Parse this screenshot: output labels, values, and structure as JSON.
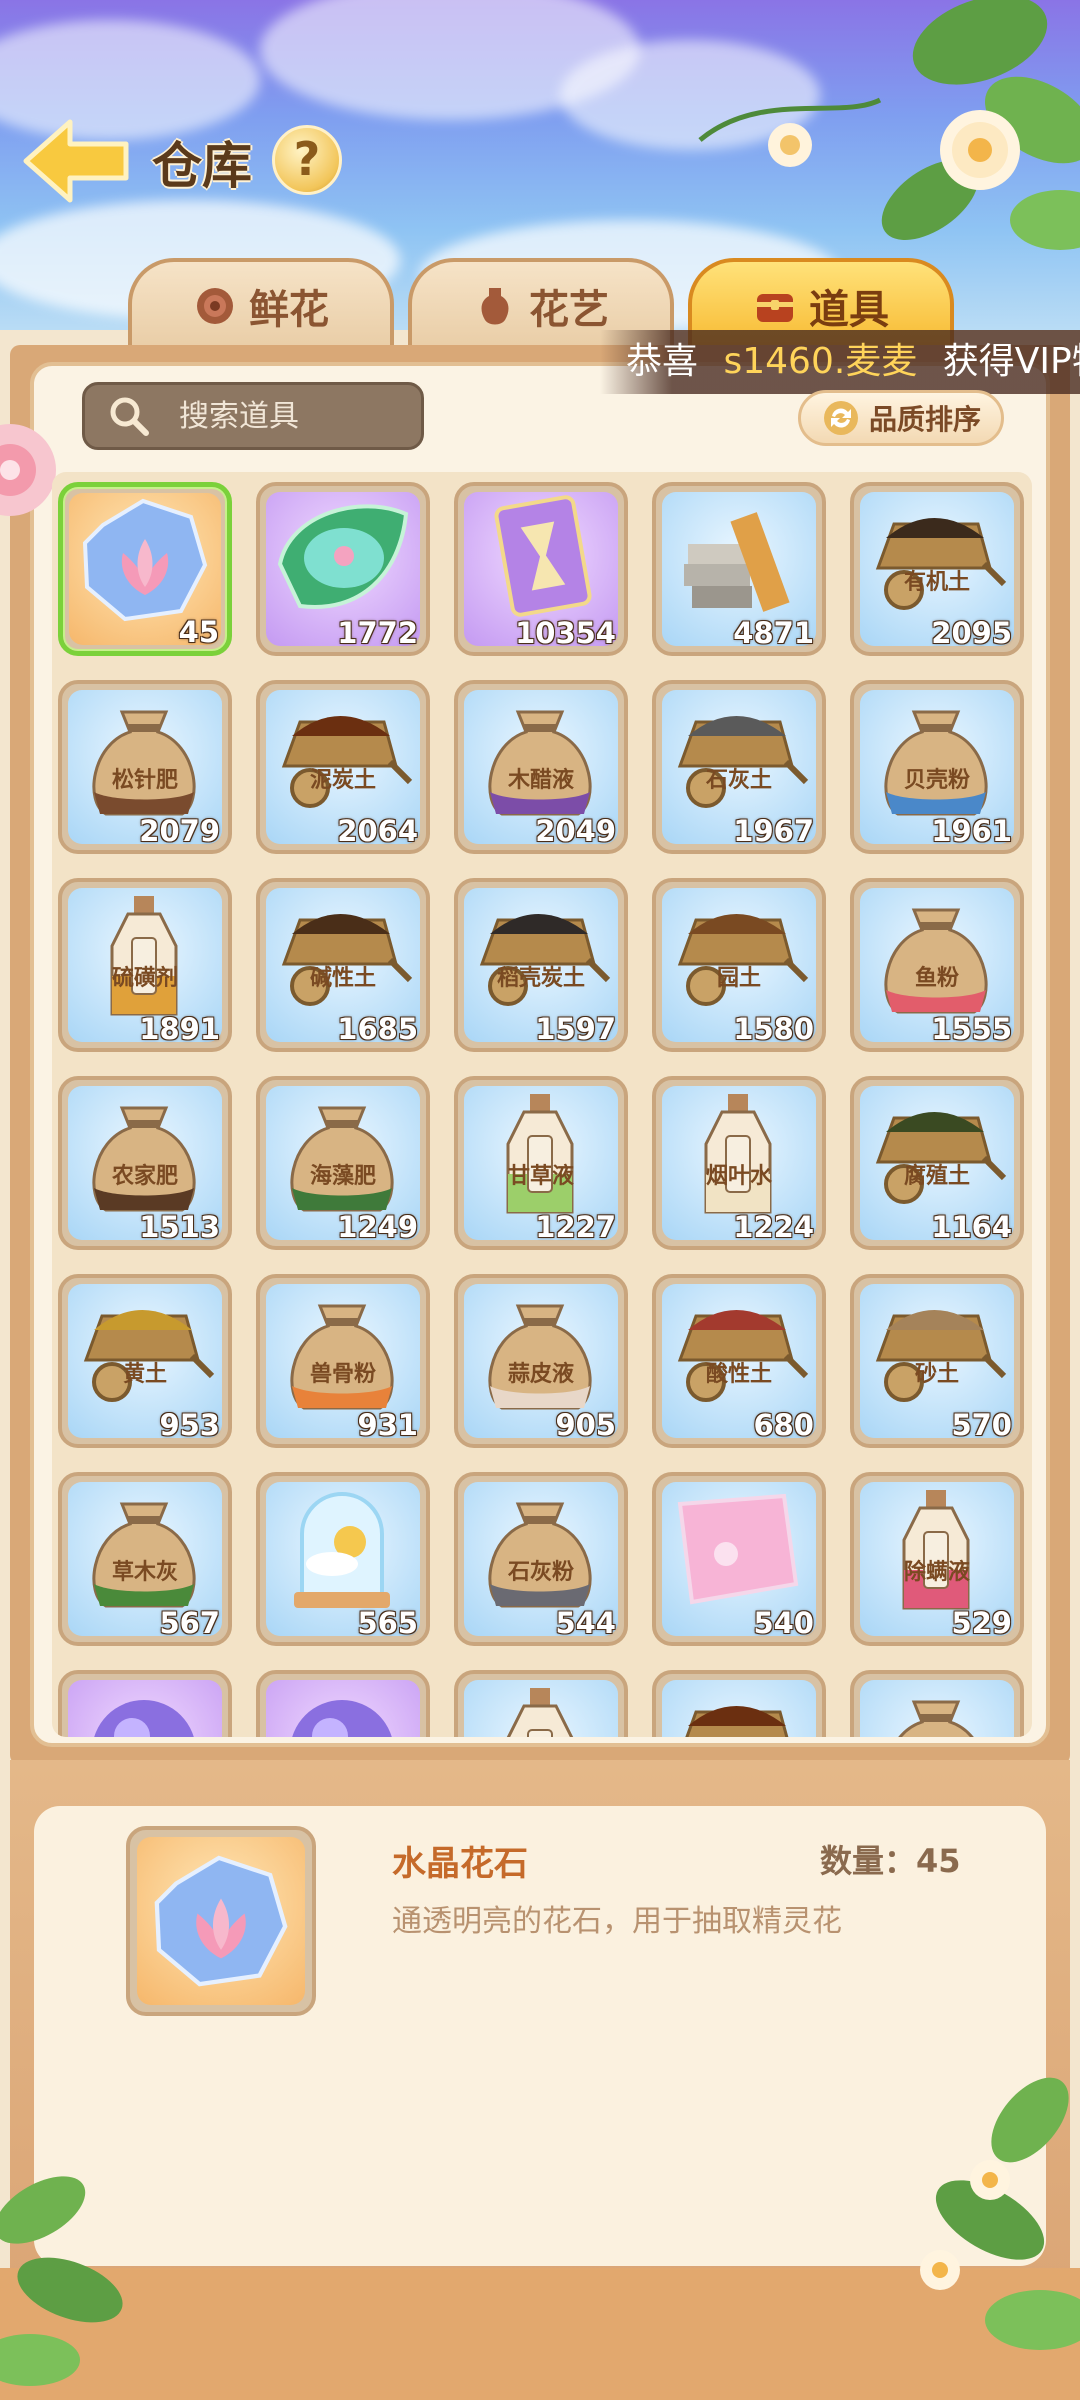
{
  "header": {
    "title": "仓库",
    "help_label": "?"
  },
  "tabs": [
    {
      "label": "鲜花",
      "active": false
    },
    {
      "label": "花艺",
      "active": false
    },
    {
      "label": "道具",
      "active": true
    }
  ],
  "ticker": {
    "prefix": "恭喜",
    "user": "s1460.麦麦",
    "suffix": "获得VIP特"
  },
  "search": {
    "placeholder": "搜索道具"
  },
  "sort": {
    "label": "品质排序"
  },
  "items": [
    {
      "count": "45",
      "label": "",
      "icon": "crystal-lotus",
      "quality": "orange",
      "selected": true
    },
    {
      "count": "1772",
      "label": "",
      "icon": "leaf-pond",
      "quality": "purple"
    },
    {
      "count": "10354",
      "label": "",
      "icon": "hourglass-card",
      "quality": "purple"
    },
    {
      "count": "4871",
      "label": "",
      "icon": "bricks-wood",
      "quality": "blue"
    },
    {
      "count": "2095",
      "label": "有机土",
      "icon": "wheelbarrow",
      "quality": "blue",
      "soil": "#3b2a1c"
    },
    {
      "count": "2079",
      "label": "松针肥",
      "icon": "sack",
      "quality": "blue",
      "band": "#7a4b2e"
    },
    {
      "count": "2064",
      "label": "泥炭土",
      "icon": "wheelbarrow",
      "quality": "blue",
      "soil": "#6b2f10"
    },
    {
      "count": "2049",
      "label": "木醋液",
      "icon": "sack",
      "quality": "blue",
      "band": "#7c4da8"
    },
    {
      "count": "1967",
      "label": "石灰土",
      "icon": "wheelbarrow",
      "quality": "blue",
      "soil": "#5a5a5a"
    },
    {
      "count": "1961",
      "label": "贝壳粉",
      "icon": "sack",
      "quality": "blue",
      "band": "#4a88c9"
    },
    {
      "count": "1891",
      "label": "硫磺剂",
      "icon": "bottle",
      "quality": "blue",
      "band": "#e0a13a"
    },
    {
      "count": "1685",
      "label": "碱性土",
      "icon": "wheelbarrow",
      "quality": "blue",
      "soil": "#4a2e18"
    },
    {
      "count": "1597",
      "label": "稻壳炭土",
      "icon": "wheelbarrow",
      "quality": "blue",
      "soil": "#2f2a28"
    },
    {
      "count": "1580",
      "label": "园土",
      "icon": "wheelbarrow",
      "quality": "blue",
      "soil": "#7a4a22"
    },
    {
      "count": "1555",
      "label": "鱼粉",
      "icon": "sack",
      "quality": "blue",
      "band": "#e25d6b"
    },
    {
      "count": "1513",
      "label": "农家肥",
      "icon": "sack",
      "quality": "blue",
      "band": "#5a3a24"
    },
    {
      "count": "1249",
      "label": "海藻肥",
      "icon": "sack",
      "quality": "blue",
      "band": "#3f7a3a"
    },
    {
      "count": "1227",
      "label": "甘草液",
      "icon": "bottle",
      "quality": "blue",
      "band": "#9ccf6a"
    },
    {
      "count": "1224",
      "label": "烟叶水",
      "icon": "bottle",
      "quality": "blue",
      "band": "#f1e3c4"
    },
    {
      "count": "1164",
      "label": "腐殖土",
      "icon": "wheelbarrow",
      "quality": "blue",
      "soil": "#3a4a22"
    },
    {
      "count": "953",
      "label": "黄土",
      "icon": "wheelbarrow",
      "quality": "blue",
      "soil": "#c79a2e"
    },
    {
      "count": "931",
      "label": "兽骨粉",
      "icon": "sack",
      "quality": "blue",
      "band": "#e8823a"
    },
    {
      "count": "905",
      "label": "蒜皮液",
      "icon": "sack",
      "quality": "blue",
      "band": "#e8d7c8"
    },
    {
      "count": "680",
      "label": "酸性土",
      "icon": "wheelbarrow",
      "quality": "blue",
      "soil": "#a33a2e"
    },
    {
      "count": "570",
      "label": "砂土",
      "icon": "wheelbarrow",
      "quality": "blue",
      "soil": "#a5835a"
    },
    {
      "count": "567",
      "label": "草木灰",
      "icon": "sack",
      "quality": "blue",
      "band": "#4a8a3a"
    },
    {
      "count": "565",
      "label": "",
      "icon": "glass-dome",
      "quality": "blue"
    },
    {
      "count": "544",
      "label": "石灰粉",
      "icon": "sack",
      "quality": "blue",
      "band": "#6a6a72"
    },
    {
      "count": "540",
      "label": "",
      "icon": "pink-cloth",
      "quality": "blue"
    },
    {
      "count": "529",
      "label": "除螨液",
      "icon": "bottle",
      "quality": "blue",
      "band": "#e05a7a"
    },
    {
      "count": "",
      "label": "",
      "icon": "purple-orb",
      "quality": "purple"
    },
    {
      "count": "",
      "label": "",
      "icon": "purple-orb",
      "quality": "purple"
    },
    {
      "count": "",
      "label": "",
      "icon": "bottle",
      "quality": "blue",
      "band": "#d8b483"
    },
    {
      "count": "",
      "label": "",
      "icon": "wheelbarrow",
      "quality": "blue",
      "soil": "#6b2f10"
    },
    {
      "count": "",
      "label": "",
      "icon": "sack",
      "quality": "blue",
      "band": "#c9a57d"
    }
  ],
  "detail": {
    "name": "水晶花石",
    "quantity_label": "数量：45",
    "description": "通透明亮的花石，用于抽取精灵花",
    "icon": "crystal-lotus"
  },
  "colors": {
    "accent": "#f7b930",
    "selected_border": "#7bd13a",
    "detail_name": "#c56a2a"
  }
}
